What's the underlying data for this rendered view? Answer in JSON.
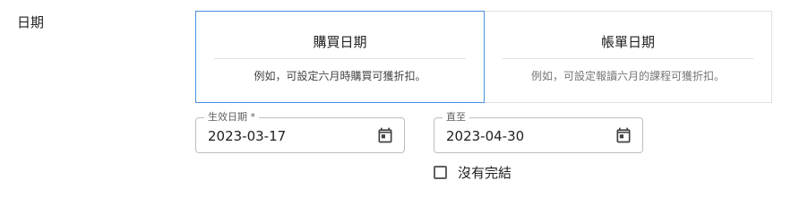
{
  "section": {
    "label": "日期"
  },
  "options": [
    {
      "title": "購買日期",
      "description": "例如，可設定六月時購買可獲折扣。",
      "selected": true
    },
    {
      "title": "帳單日期",
      "description": "例如，可設定報讀六月的課程可獲折扣。",
      "selected": false
    }
  ],
  "start_date": {
    "label": "生效日期 *",
    "value": "2023-03-17",
    "icon": "calendar-icon"
  },
  "end_date": {
    "label": "直至",
    "value": "2023-04-30",
    "icon": "calendar-icon"
  },
  "no_end": {
    "label": "沒有完結",
    "checked": false
  },
  "colors": {
    "selected_border": "#4a90e2",
    "border": "#e0e0e0",
    "icon": "#424242"
  }
}
